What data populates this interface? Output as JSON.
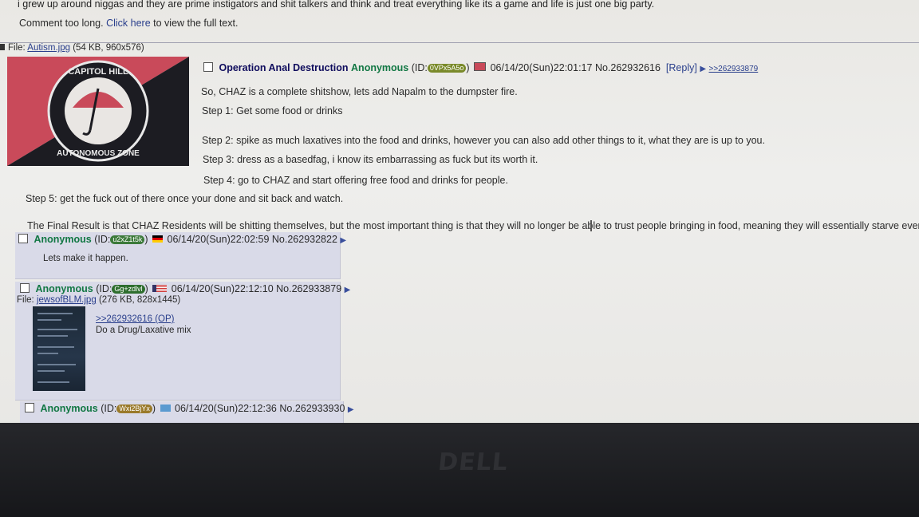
{
  "prev_post": {
    "text_tail": "i grew up around niggas and they are prime instigators and shit talkers and think and treat everything like its a game and life is just one big party.",
    "comment_too_long": "Comment too long.",
    "click_here": "Click here",
    "view_full_text": "to view the full text."
  },
  "op": {
    "file_label": "File:",
    "file_name": "Autism.jpg",
    "file_info": "(54 KB, 960x576)",
    "image_text_top": "CAPITOL HILL",
    "image_text_bottom": "AUTONOMOUS ZONE",
    "subject": "Operation Anal Destruction",
    "name": "Anonymous",
    "id_prefix": "(ID:",
    "id": "0VPx5A5o",
    "id_suffix": ")",
    "id_color": "#7a8a2a",
    "datetime": "06/14/20(Sun)22:01:17",
    "post_no": "No.262932616",
    "reply_label": "[Reply]",
    "backlink": ">>262933879",
    "lines": [
      "So, CHAZ is a complete shitshow, lets add Napalm to the dumpster fire.",
      "Step 1: Get some food or drinks",
      "Step 2: spike as much laxatives into the food and drinks, however you can also add other things to it, what they are is up to you.",
      "Step 3: dress as a basedfag, i know its embarrassing as fuck but its worth it.",
      "Step 4: go to CHAZ and start offering free food and drinks for people.",
      "Step 5: get the fuck out of there once your done and sit back and watch.",
      "The Final Result is that CHAZ Residents will be shitting themselves, but the most important thing is that they will no longer be able to trust people bringing in food, meaning they will essentially starve even faster."
    ]
  },
  "replies": [
    {
      "name": "Anonymous",
      "id_prefix": "(ID:",
      "id": "u2xZ1t5k",
      "id_suffix": ")",
      "id_color": "#3c7a3a",
      "datetime": "06/14/20(Sun)22:02:59",
      "post_no": "No.262932822",
      "text": "Lets make it happen."
    },
    {
      "name": "Anonymous",
      "id_prefix": "(ID:",
      "id": "Gg+zdlvl",
      "id_suffix": ")",
      "id_color": "#2e6e2e",
      "datetime": "06/14/20(Sun)22:12:10",
      "post_no": "No.262933879",
      "file_label": "File:",
      "file_name": "jewsofBLM.jpg",
      "file_info": "(276 KB, 828x1445)",
      "quote": ">>262932616 (OP)",
      "text": "Do a Drug/Laxative mix"
    },
    {
      "name": "Anonymous",
      "id_prefix": "(ID:",
      "id": "Wxi2BjYx",
      "id_suffix": ")",
      "id_color": "#9a7a2a",
      "datetime": "06/14/20(Sun)22:12:36",
      "post_no": "No.262933930"
    }
  ],
  "monitor": {
    "brand": "DELL"
  },
  "colors": {
    "screen_bg": "#eeeeec",
    "reply_bg": "#d9dae8",
    "subject": "#0f0c5d",
    "name": "#117743",
    "link": "#2a3f8c",
    "flag_red": "#c94a5a",
    "flag_dark": "#1c1c22"
  },
  "icons": [
    "checkbox-icon",
    "flag-icon",
    "post-menu-arrow-icon",
    "umbrella-icon"
  ]
}
